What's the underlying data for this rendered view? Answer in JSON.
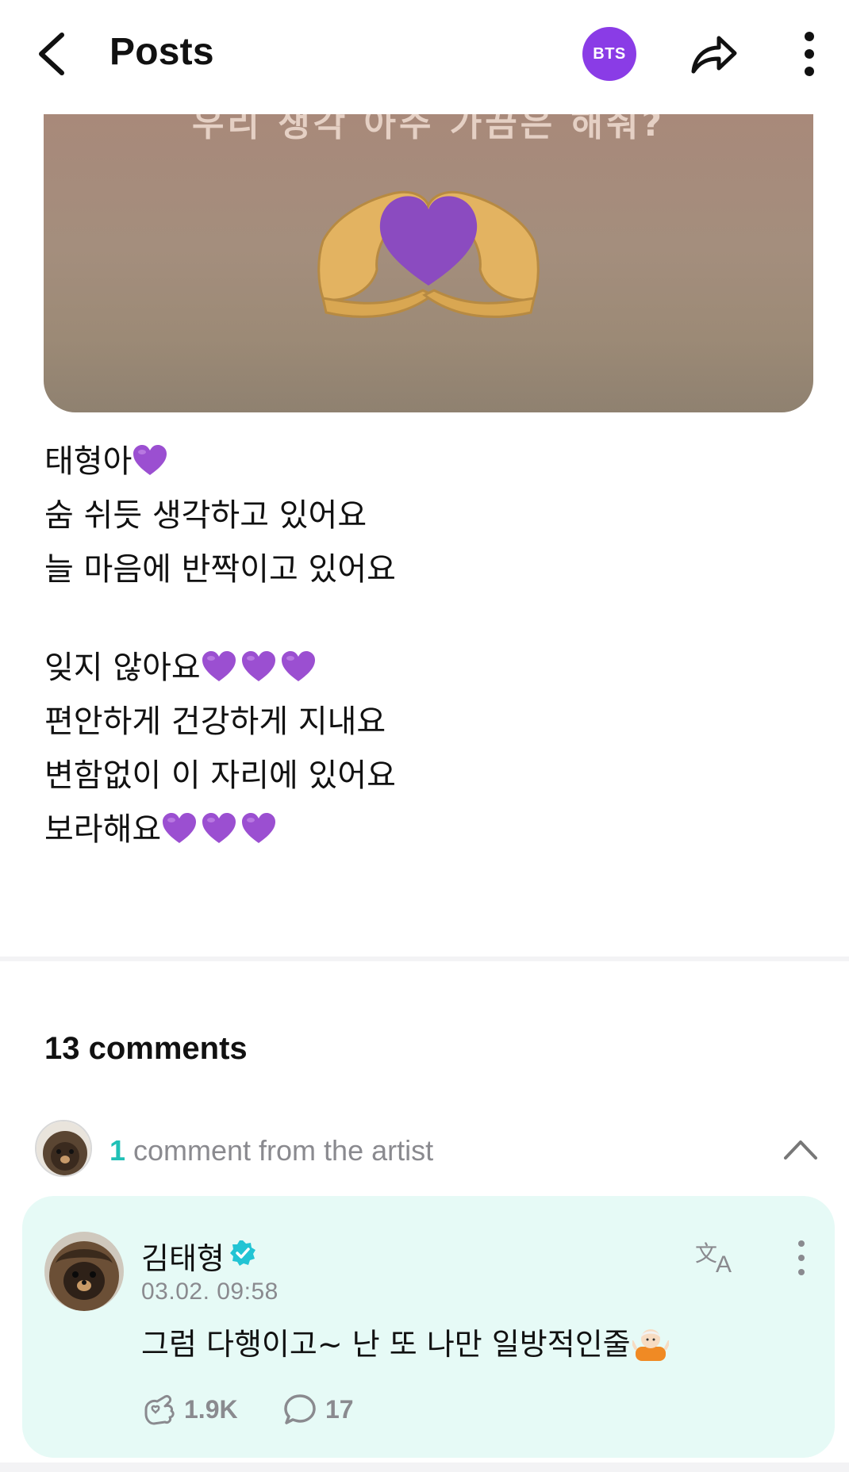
{
  "header": {
    "title": "Posts",
    "community_badge": "BTS",
    "icons": {
      "back": "chevron-left-icon",
      "share": "share-arrow-icon",
      "more": "vertical-dots-icon"
    },
    "badge_color": "#8a3ce6"
  },
  "post": {
    "image_caption": "우리 생각 아주 가끔은 해줘?",
    "lines": [
      {
        "text": "태형아",
        "hearts": 1
      },
      {
        "text": "숨 쉬듯 생각하고 있어요",
        "hearts": 0
      },
      {
        "text": "늘 마음에 반짝이고 있어요",
        "hearts": 0
      },
      {
        "text": "잊지 않아요",
        "hearts": 3
      },
      {
        "text": "편안하게 건강하게 지내요",
        "hearts": 0
      },
      {
        "text": "변함없이 이 자리에 있어요",
        "hearts": 0
      },
      {
        "text": "보라해요",
        "hearts": 3
      }
    ],
    "heart_color": "#9b4fd1"
  },
  "comments": {
    "count_label": "13 comments",
    "artist_summary": {
      "count": "1",
      "label": "comment from the artist"
    },
    "accent_color": "#20c0b6",
    "artist_comment": {
      "author": "김태형",
      "verified": true,
      "timestamp": "03.02. 09:58",
      "text": "그럼 다행이고~ 난 또 나만 일방적인줄",
      "likes": "1.9K",
      "replies": "17",
      "card_color": "#e6faf6"
    }
  }
}
